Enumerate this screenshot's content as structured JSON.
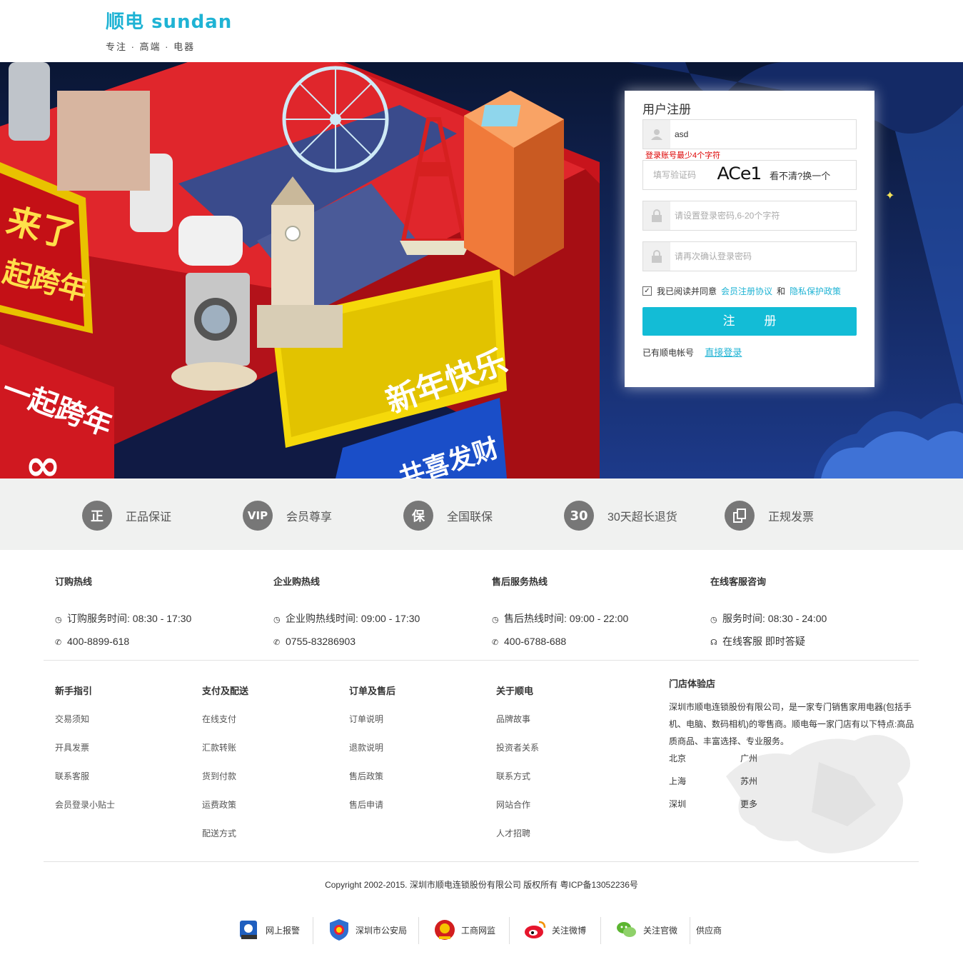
{
  "header": {
    "logo_cn": "顺电",
    "logo_en": "sundan",
    "tagline": "专注 · 高端 · 电器"
  },
  "banner": {
    "text_1": "来了",
    "text_2": "起跨年",
    "text_3": "一起跨年",
    "text_4": "新年快乐",
    "text_5": "共喜发财"
  },
  "register": {
    "title": "用户注册",
    "username_value": "asd",
    "username_error": "登录账号最少4个字符",
    "captcha_placeholder": "填写验证码",
    "captcha_text": "ACe1",
    "captcha_refresh": "看不清?换一个",
    "password_placeholder": "请设置登录密码,6-20个字符",
    "confirm_placeholder": "请再次确认登录密码",
    "agree_text": "我已阅读并同意",
    "agree_link1": "会员注册协议",
    "agree_and": "和",
    "agree_link2": "隐私保护政策",
    "submit_label": "注 册",
    "have_account": "已有顺电帐号",
    "login_link": "直接登录"
  },
  "features": [
    {
      "icon_text": "正",
      "label": "正品保证"
    },
    {
      "icon_text": "VIP",
      "label": "会员尊享"
    },
    {
      "icon_text": "保",
      "label": "全国联保"
    },
    {
      "icon_text": "30",
      "label": "30天超长退货"
    },
    {
      "icon_text": "",
      "label": "正规发票"
    }
  ],
  "hotlines": [
    {
      "title": "订购热线",
      "line1": "订购服务时间: 08:30 - 17:30",
      "line2": "400-8899-618",
      "icon1": "clock-icon",
      "icon2": "phone-icon"
    },
    {
      "title": "企业购热线",
      "line1": "企业购热线时间: 09:00 - 17:30",
      "line2": "0755-83286903",
      "icon1": "clock-icon",
      "icon2": "phone-icon"
    },
    {
      "title": "售后服务热线",
      "line1": "售后热线时间: 09:00 - 22:00",
      "line2": "400-6788-688",
      "icon1": "clock-icon",
      "icon2": "phone-icon"
    },
    {
      "title": "在线客服咨询",
      "line1": "服务时间: 08:30 - 24:00",
      "line2": "在线客服 即时答疑",
      "icon1": "clock-icon",
      "icon2": "headset-icon"
    }
  ],
  "link_columns": [
    {
      "title": "新手指引",
      "items": [
        "交易须知",
        "开具发票",
        "联系客服",
        "会员登录小贴士"
      ]
    },
    {
      "title": "支付及配送",
      "items": [
        "在线支付",
        "汇款转账",
        "货到付款",
        "运费政策",
        "配送方式"
      ]
    },
    {
      "title": "订单及售后",
      "items": [
        "订单说明",
        "退款说明",
        "售后政策",
        "售后申请"
      ]
    },
    {
      "title": "关于顺电",
      "items": [
        "品牌故事",
        "投资者关系",
        "联系方式",
        "网站合作",
        "人才招聘"
      ]
    }
  ],
  "store": {
    "title": "门店体验店",
    "desc": "深圳市顺电连锁股份有限公司，是一家专门销售家用电器(包括手机、电脑、数码相机)的零售商。顺电每一家门店有以下特点:高品质商品、丰富选择、专业服务。",
    "cities": [
      "北京",
      "广州",
      "上海",
      "苏州",
      "深圳",
      "更多"
    ]
  },
  "copyright": "Copyright 2002-2015. 深圳市顺电连锁股份有限公司 版权所有 粤ICP备13052236号",
  "footer_badges": [
    {
      "label": "网上报警",
      "icon": "police-icon"
    },
    {
      "label": "深圳市公安局",
      "icon": "shield-badge-icon"
    },
    {
      "label": "工商网监",
      "icon": "emblem-icon"
    },
    {
      "label": "关注微博",
      "icon": "weibo-icon"
    },
    {
      "label": "关注官微",
      "icon": "wechat-icon"
    },
    {
      "label": "供应商",
      "icon": ""
    }
  ],
  "colors": {
    "accent": "#13bcd6",
    "error": "#dd0000",
    "banner_red": "#d81a22"
  }
}
